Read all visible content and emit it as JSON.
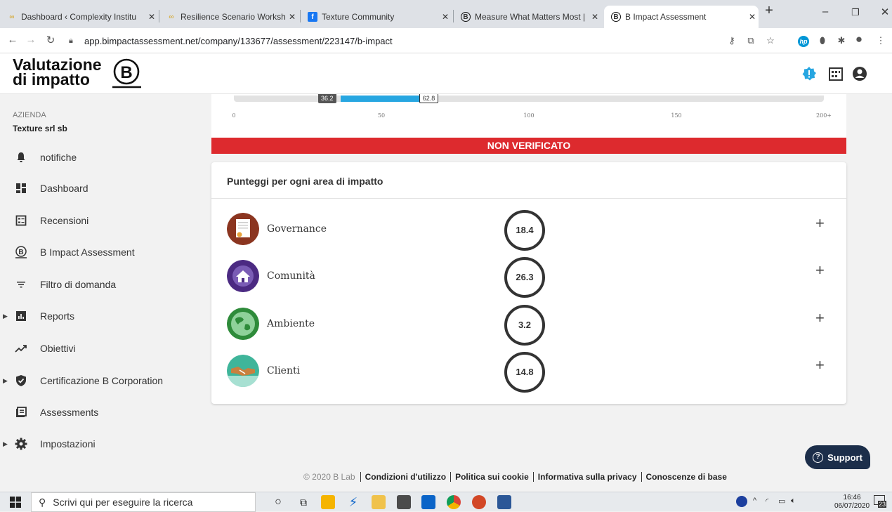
{
  "browser": {
    "tabs": [
      {
        "title": "Dashboard ‹ Complexity Institu",
        "active": false
      },
      {
        "title": "Resilience Scenario Workshop",
        "active": false
      },
      {
        "title": "Texture Community",
        "active": false
      },
      {
        "title": "Measure What Matters Most | ",
        "active": false
      },
      {
        "title": "B Impact Assessment",
        "active": true
      }
    ],
    "new_tab": "+",
    "url": "app.bimpactassessment.net/company/133677/assessment/223147/b-impact"
  },
  "header": {
    "logo_line1": "Valutazione",
    "logo_line2": "di impatto"
  },
  "sidebar": {
    "company_caption": "AZIENDA",
    "company_name": "Texture srl sb",
    "items": [
      {
        "label": "notifiche",
        "icon": "bell-icon",
        "expandable": false
      },
      {
        "label": "Dashboard",
        "icon": "dashboard-icon",
        "expandable": false
      },
      {
        "label": "Recensioni",
        "icon": "reviews-icon",
        "expandable": false
      },
      {
        "label": "B Impact Assessment",
        "icon": "b-circle-icon",
        "expandable": false
      },
      {
        "label": "Filtro di domanda",
        "icon": "filter-icon",
        "expandable": false
      },
      {
        "label": "Reports",
        "icon": "bar-chart-icon",
        "expandable": true
      },
      {
        "label": "Obiettivi",
        "icon": "trend-icon",
        "expandable": false
      },
      {
        "label": "Certificazione B Corporation",
        "icon": "shield-check-icon",
        "expandable": true
      },
      {
        "label": "Assessments",
        "icon": "list-icon",
        "expandable": false
      },
      {
        "label": "Impostazioni",
        "icon": "gear-icon",
        "expandable": true
      }
    ]
  },
  "score_bar": {
    "value_dark": "36.2",
    "value_light": "62.8",
    "fill_from": 36.2,
    "fill_to": 62.8,
    "max": 200,
    "ticks": [
      "0",
      "50",
      "100",
      "150",
      "200+"
    ]
  },
  "status_banner": "NON VERIFICATO",
  "impact_card": {
    "title": "Punteggi per ogni area di impatto",
    "areas": [
      {
        "name": "Governance",
        "score": "18.4"
      },
      {
        "name": "Comunità",
        "score": "26.3"
      },
      {
        "name": "Ambiente",
        "score": "3.2"
      },
      {
        "name": "Clienti",
        "score": "14.8"
      }
    ],
    "expand_symbol": "+"
  },
  "support": {
    "label": "Support"
  },
  "footer": {
    "copyright": "© 2020 B Lab",
    "links": [
      "Condizioni d'utilizzo",
      "Politica sui cookie",
      "Informativa sulla privacy",
      "Conoscenze di base"
    ]
  },
  "taskbar": {
    "search_placeholder": "Scrivi qui per eseguire la ricerca",
    "time": "16:46",
    "date": "06/07/2020",
    "notification_count": "23"
  },
  "colors": {
    "accent_blue": "#27a6e1",
    "banner_red": "#dd2a2e",
    "support_navy": "#1c2e4a"
  }
}
